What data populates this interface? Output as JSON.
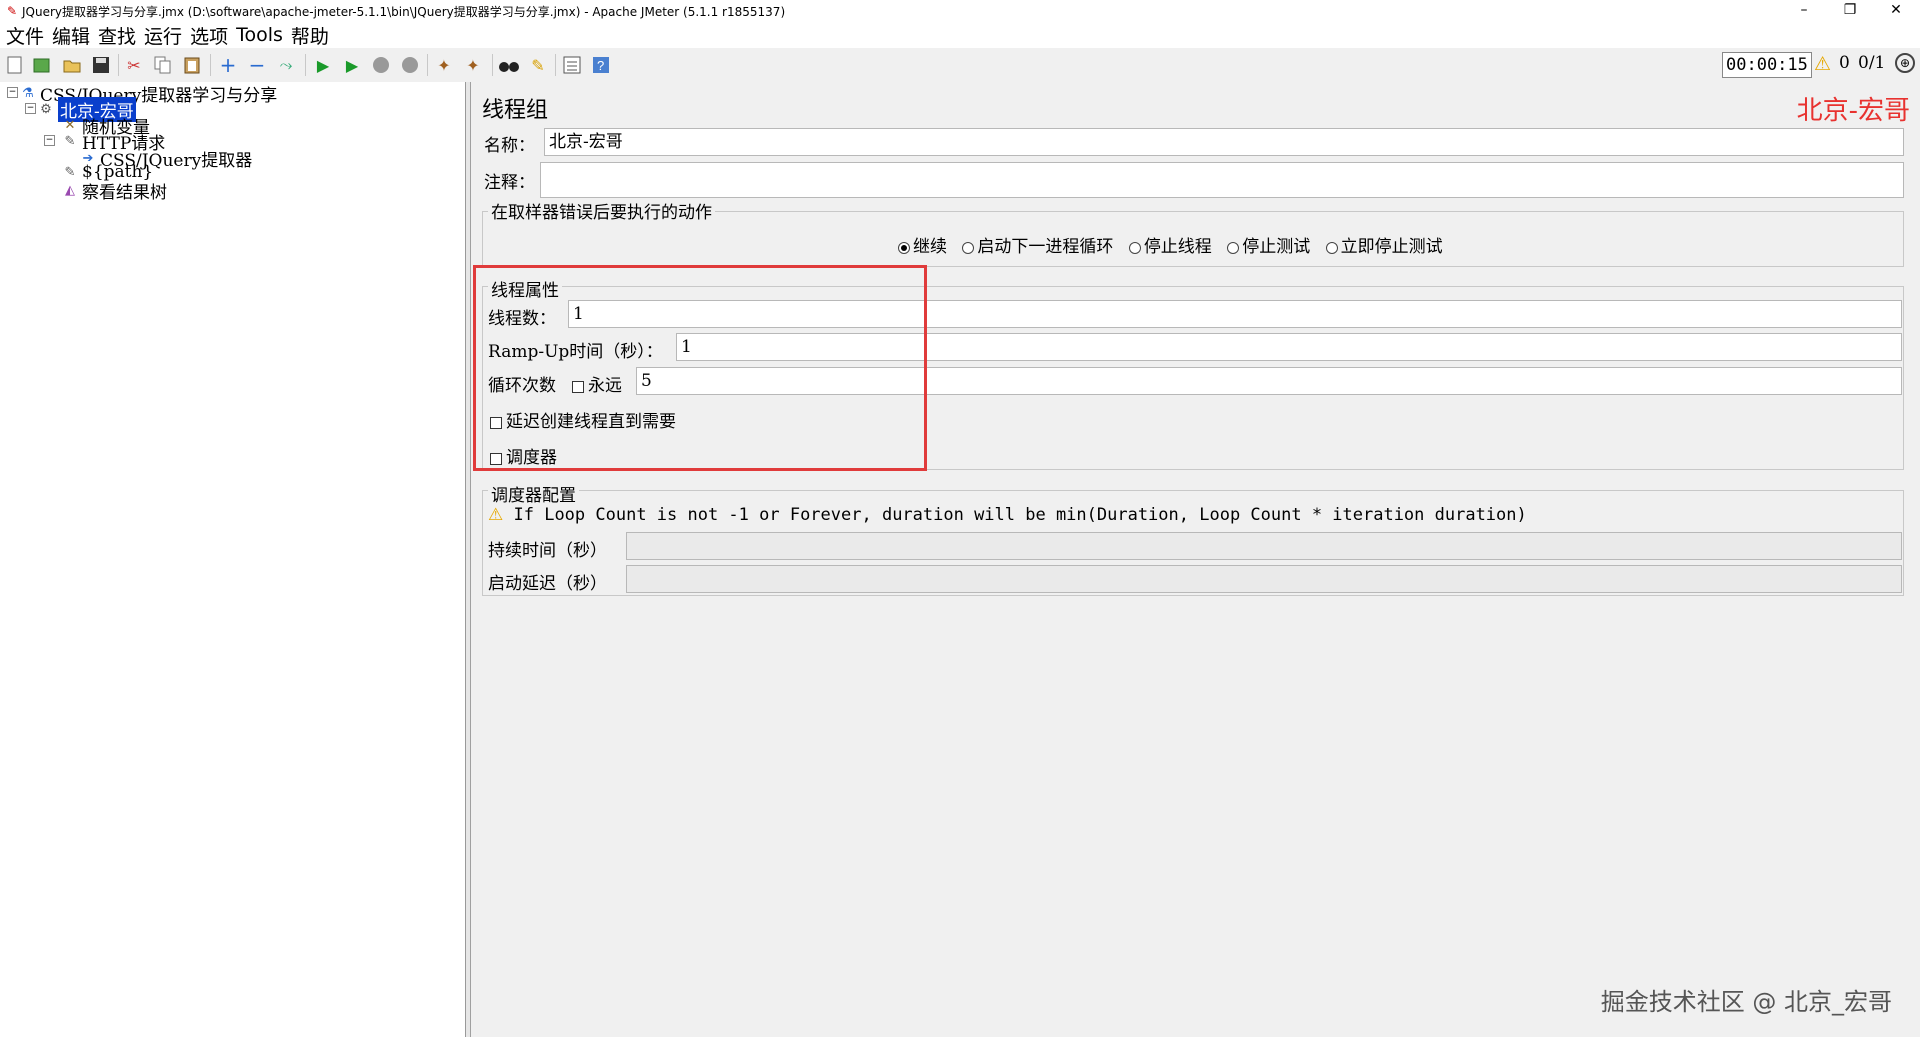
{
  "window": {
    "title": "JQuery提取器学习与分享.jmx (D:\\software\\apache-jmeter-5.1.1\\bin\\JQuery提取器学习与分享.jmx) - Apache JMeter (5.1.1 r1855137)",
    "minimize": "–",
    "maximize": "❐",
    "close": "✕"
  },
  "menu": [
    "文件",
    "编辑",
    "查找",
    "运行",
    "选项",
    "Tools",
    "帮助"
  ],
  "toolbar": {
    "timer": "00:00:15",
    "warning_count": "0",
    "threads": "0/1"
  },
  "tree": {
    "root": "CSS/JQuery提取器学习与分享",
    "thread_group": "北京-宏哥",
    "random_var": "随机变量",
    "http_request": "HTTP请求",
    "extractor": "CSS/JQuery提取器",
    "path_var": "${path}",
    "result_tree": "察看结果树"
  },
  "panel": {
    "title": "线程组",
    "brand": "北京-宏哥",
    "name_label": "名称：",
    "name_value": "北京-宏哥",
    "comment_label": "注释：",
    "comment_value": "",
    "error_group_title": "在取样器错误后要执行的动作",
    "error_actions": [
      "继续",
      "启动下一进程循环",
      "停止线程",
      "停止测试",
      "立即停止测试"
    ],
    "error_selected": 0,
    "thread_props_title": "线程属性",
    "threads_label": "线程数：",
    "threads_value": "1",
    "rampup_label": "Ramp-Up时间（秒）：",
    "rampup_value": "1",
    "loop_label": "循环次数",
    "forever_label": "永远",
    "loop_value": "5",
    "delay_label": "延迟创建线程直到需要",
    "scheduler_label": "调度器",
    "scheduler_group_title": "调度器配置",
    "scheduler_warning": "If Loop Count is not -1 or Forever, duration will be min(Duration, Loop Count * iteration duration)",
    "duration_label": "持续时间（秒）",
    "duration_value": "",
    "startup_delay_label": "启动延迟（秒）",
    "startup_delay_value": ""
  },
  "watermark": "掘金技术社区 @ 北京_宏哥"
}
